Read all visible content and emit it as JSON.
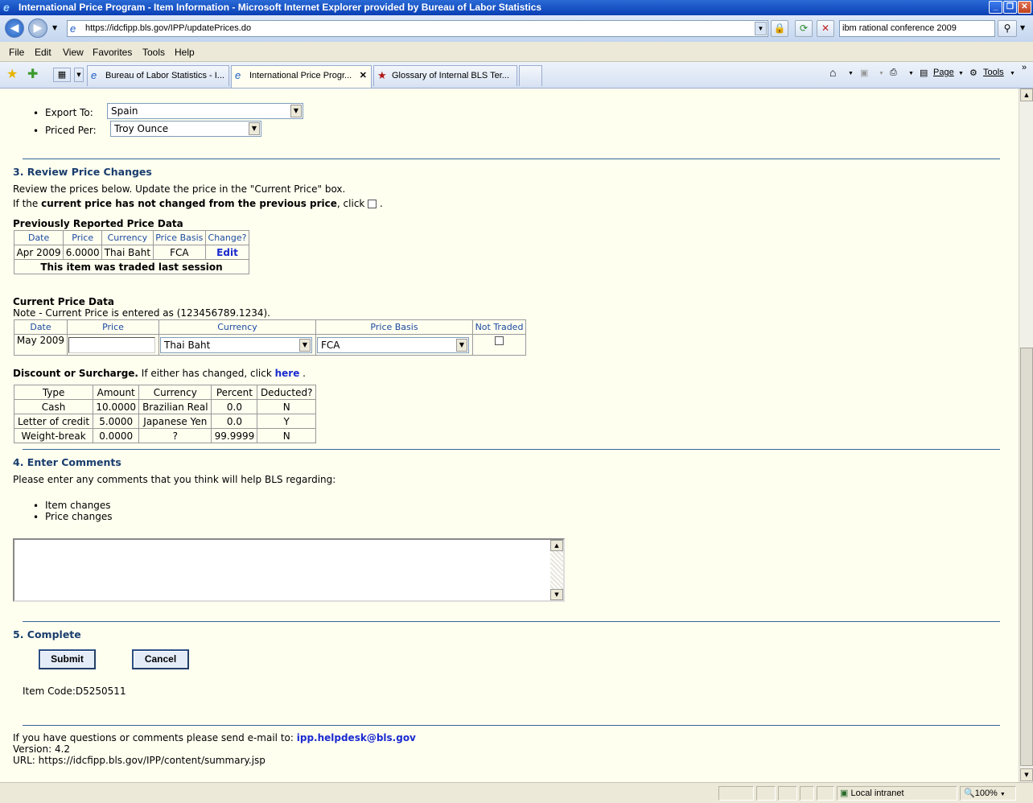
{
  "window": {
    "title": "International Price Program - Item Information - Microsoft Internet Explorer provided by Bureau of Labor Statistics"
  },
  "address": {
    "url": "https://idcfipp.bls.gov/IPP/updatePrices.do",
    "search_value": "ibm rational conference 2009"
  },
  "menu": [
    "File",
    "Edit",
    "View",
    "Favorites",
    "Tools",
    "Help"
  ],
  "tabs": [
    {
      "label": "Bureau of Labor Statistics - I..."
    },
    {
      "label": "International Price Progr..."
    },
    {
      "label": "Glossary of Internal BLS Ter..."
    }
  ],
  "toolbar": {
    "page_label": "Page",
    "tools_label": "Tools"
  },
  "form": {
    "export_label": "Export To:",
    "export_value": "Spain",
    "priced_label": "Priced Per:",
    "priced_value": "Troy Ounce"
  },
  "section3": {
    "title": "3. Review Price Changes",
    "line1": "Review the prices below. Update the price in the \"Current Price\" box.",
    "line2_pre": "If the ",
    "line2_bold": "current price has not changed from the previous price",
    "line2_post": ", click",
    "prev_title": "Previously Reported Price Data",
    "prev_headers": [
      "Date",
      "Price",
      "Currency",
      "Price Basis",
      "Change?"
    ],
    "prev_row": {
      "date": "Apr 2009",
      "price": "6.0000",
      "currency": "Thai Baht",
      "basis": "FCA",
      "change": "Edit"
    },
    "prev_note": "This item was traded last session",
    "cur_title": "Current Price Data",
    "cur_note": "Note - Current Price is entered as (123456789.1234).",
    "cur_headers": [
      "Date",
      "Price",
      "Currency",
      "Price Basis",
      "Not Traded"
    ],
    "cur_row": {
      "date": "May 2009",
      "price": "",
      "currency": "Thai Baht",
      "basis": "FCA"
    },
    "disc_bold": "Discount or Surcharge.",
    "disc_text": " If either has changed, click ",
    "disc_link": "here",
    "disc_headers": [
      "Type",
      "Amount",
      "Currency",
      "Percent",
      "Deducted?"
    ],
    "disc_rows": [
      [
        "Cash",
        "10.0000",
        "Brazilian Real",
        "0.0",
        "N"
      ],
      [
        "Letter of credit",
        "5.0000",
        "Japanese Yen",
        "0.0",
        "Y"
      ],
      [
        "Weight-break",
        "0.0000",
        "?",
        "99.9999",
        "N"
      ]
    ]
  },
  "section4": {
    "title": "4. Enter Comments",
    "prompt": "Please enter any comments that you think will help BLS regarding:",
    "bullets": [
      "Item changes",
      "Price changes"
    ],
    "comment_value": ""
  },
  "section5": {
    "title": "5. Complete",
    "submit": "Submit",
    "cancel": "Cancel",
    "item_code": "Item Code:D5250511"
  },
  "footer": {
    "contact": "If you have questions or comments please send e-mail to: ",
    "email": "ipp.helpdesk@bls.gov",
    "version": "Version: 4.2",
    "url": "URL: https://idcfipp.bls.gov/IPP/content/summary.jsp"
  },
  "status": {
    "zone": "Local intranet",
    "zoom": "100%"
  }
}
